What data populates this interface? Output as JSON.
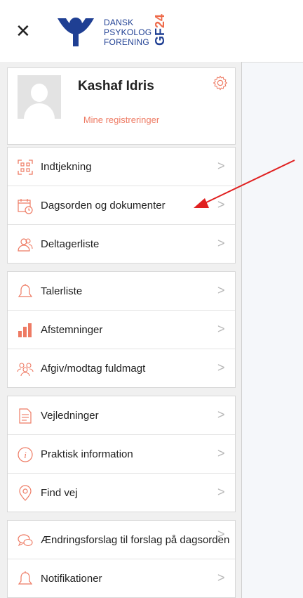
{
  "header": {
    "logo_lines": [
      "DANSK",
      "PSYKOLOG",
      "FORENING"
    ],
    "badge_prefix": "GF",
    "badge_number": "24",
    "close_icon": "close-icon"
  },
  "profile": {
    "name": "Kashaf Idris",
    "registrations_link": "Mine registreringer"
  },
  "menu_groups": [
    [
      {
        "label": "Indtjekning",
        "icon": "qr-code-icon"
      },
      {
        "label": "Dagsorden og dokumenter",
        "icon": "calendar-clock-icon"
      },
      {
        "label": "Deltagerliste",
        "icon": "users-icon"
      }
    ],
    [
      {
        "label": "Talerliste",
        "icon": "bell-icon"
      },
      {
        "label": "Afstemninger",
        "icon": "bar-chart-icon"
      },
      {
        "label": "Afgiv/modtag fuldmagt",
        "icon": "group-icon"
      }
    ],
    [
      {
        "label": "Vejledninger",
        "icon": "document-icon"
      },
      {
        "label": "Praktisk information",
        "icon": "info-icon"
      },
      {
        "label": "Find vej",
        "icon": "location-pin-icon"
      }
    ],
    [
      {
        "label": "Ændringsforslag til forslag på dagsorden",
        "icon": "speech-bubbles-icon"
      },
      {
        "label": "Notifikationer",
        "icon": "bell-icon"
      }
    ]
  ],
  "colors": {
    "brand_blue": "#1f3f93",
    "accent_orange": "#ee6a4a",
    "annotation_red": "#e02020"
  }
}
